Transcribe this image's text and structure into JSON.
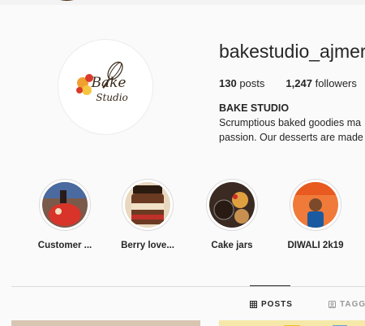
{
  "profile": {
    "username": "bakestudio_ajmer",
    "posts_count": "130",
    "posts_label": "posts",
    "followers_count": "1,247",
    "followers_label": "followers",
    "full_name": "BAKE STUDIO",
    "bio_line1": "Scrumptious baked goodies ma",
    "bio_line2": "passion. Our desserts are made",
    "logo_text_1": "Bake",
    "logo_text_2": "Studio"
  },
  "highlights": [
    {
      "label": "Customer ...",
      "icon": "cake-photo"
    },
    {
      "label": "Berry love...",
      "icon": "dessert-jar-photo"
    },
    {
      "label": "Cake jars",
      "icon": "cake-jars-photo"
    },
    {
      "label": "DIWALI 2k19",
      "icon": "person-photo"
    }
  ],
  "tabs": {
    "posts": "POSTS",
    "tagged": "TAGG"
  },
  "colors": {
    "accent_orange": "#f0a030",
    "logo_red": "#d93a2b",
    "logo_ink": "#3a2a1a"
  }
}
